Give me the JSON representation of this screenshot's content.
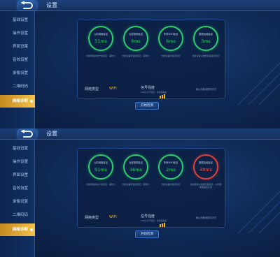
{
  "colors": {
    "accent": "#f5b21f",
    "ok": "#2ecc71",
    "bad": "#e0403c",
    "bg": "#0f2a57"
  },
  "panels": [
    {
      "title": "设置",
      "sidebar": [
        "基础设置",
        "操作设置",
        "界面设置",
        "音效设置",
        "录像设置",
        "二维码码",
        "网络诊断"
      ],
      "active_index": 6,
      "gauges": [
        {
          "label": "以前网络延迟",
          "value": "31ms",
          "status": "ok",
          "desc": "当前网络的到宁的延迟，需较小"
        },
        {
          "label": "比较宽带延迟",
          "value": "9ms",
          "status": "ok",
          "desc": "当前设备带宽的延迟，需较小"
        },
        {
          "label": "所有WIFI延迟",
          "value": "6ms",
          "status": "ok",
          "desc": "当前设备的延迟情况"
        },
        {
          "label": "数据及其延迟",
          "value": "3ms",
          "status": "ok",
          "desc": "当前设备以数据及其延迟情况"
        }
      ],
      "net_label": "网络类型",
      "net_value": "WIFI",
      "sig_label": "信号强度",
      "sig_note": "WIFI信号不稳定，请靠近路由",
      "net_desc": "确认设备网络的状况",
      "button": "开始检测"
    },
    {
      "title": "设置",
      "sidebar": [
        "基础设置",
        "操作设置",
        "界面设置",
        "音效设置",
        "录像设置",
        "二维码码",
        "网络诊断"
      ],
      "active_index": 6,
      "gauges": [
        {
          "label": "以前网络延迟",
          "value": "91ms",
          "status": "ok",
          "desc": "当前网络的到宁的延迟，需较小"
        },
        {
          "label": "比较宽带延迟",
          "value": "36ms",
          "status": "ok",
          "desc": "当前设备带宽的延迟，需较小"
        },
        {
          "label": "所有WIFI延迟",
          "value": "2ms",
          "status": "ok",
          "desc": "当前设备的延迟情况"
        },
        {
          "label": "数据及其延迟",
          "value": "30ms",
          "status": "bad",
          "desc": "当前数据以数据及其延迟，以判断数据是否正常"
        }
      ],
      "net_label": "网络类型",
      "net_value": "WIFI",
      "sig_label": "信号强度",
      "sig_note": "WIFI信号不稳定，请靠近路由",
      "net_desc": "确认设备网络的状况",
      "button": "开始检测"
    }
  ]
}
